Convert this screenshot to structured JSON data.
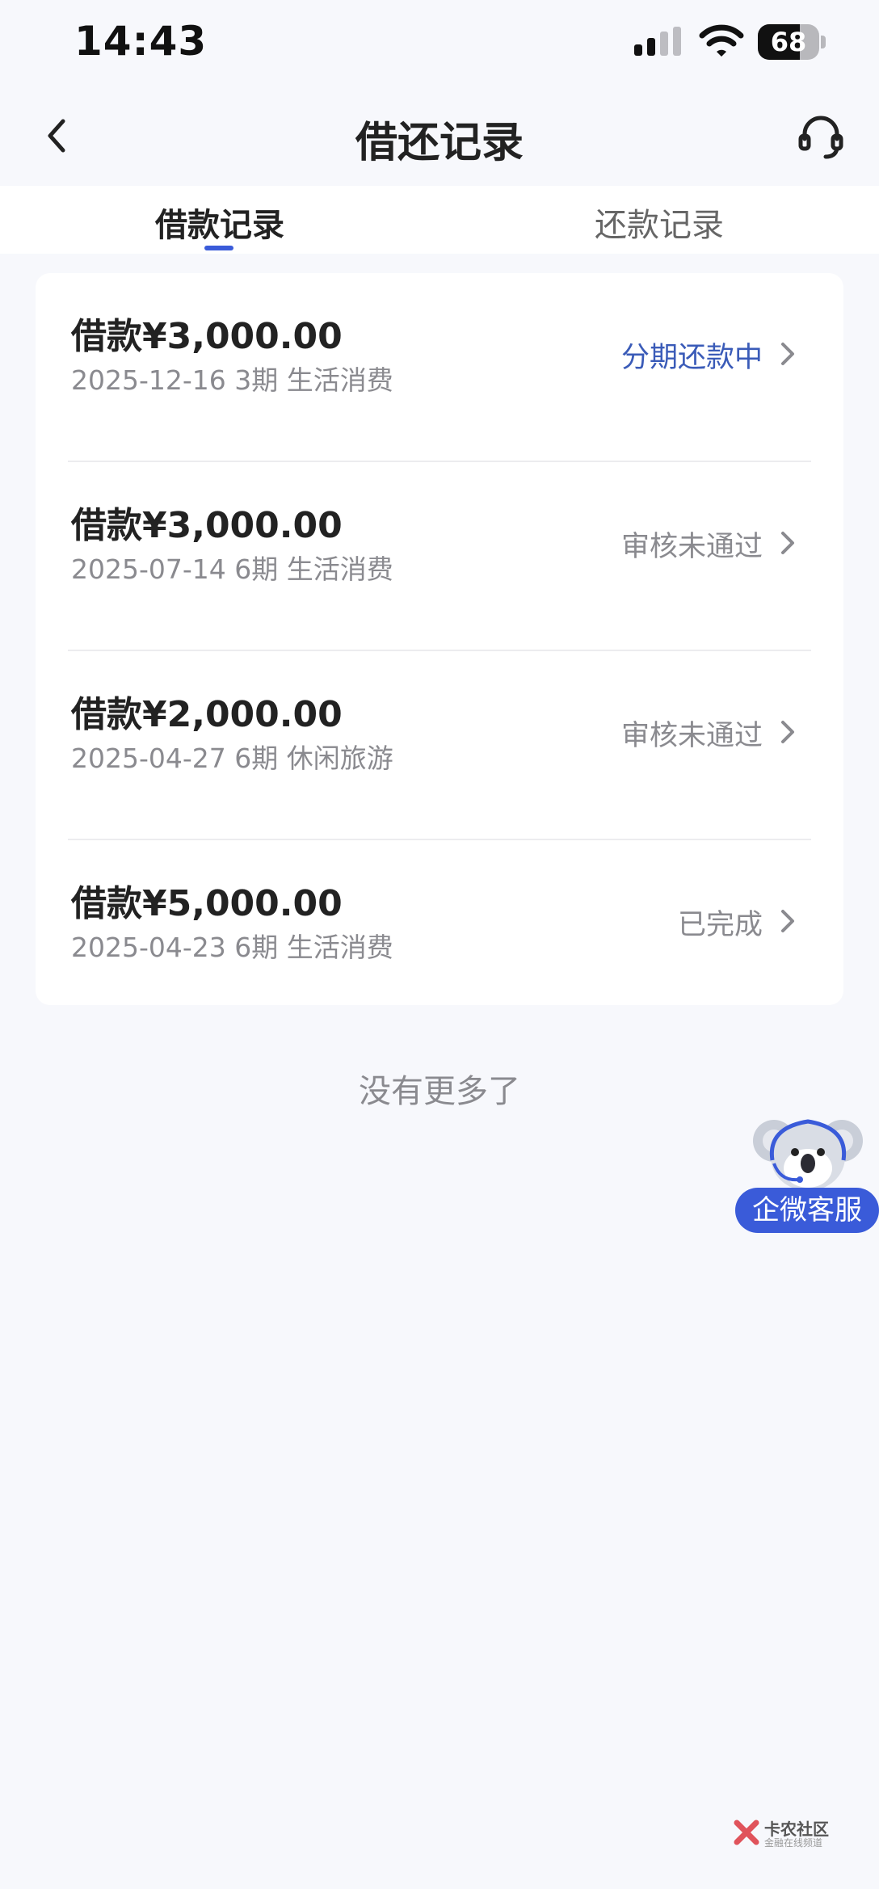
{
  "status_bar": {
    "time": "14:43",
    "battery": "68",
    "battery_level": 0.68
  },
  "nav": {
    "title": "借还记录",
    "back_icon": "chevron-left-icon",
    "cs_icon": "headset-icon"
  },
  "tabs": [
    {
      "label": "借款记录",
      "active": true
    },
    {
      "label": "还款记录",
      "active": false
    }
  ],
  "records": [
    {
      "amount": "借款¥3,000.00",
      "meta": "2025-12-16 3期  生活消费",
      "status": "分期还款中",
      "status_active": true
    },
    {
      "amount": "借款¥3,000.00",
      "meta": "2025-07-14 6期  生活消费",
      "status": "审核未通过",
      "status_active": false
    },
    {
      "amount": "借款¥2,000.00",
      "meta": "2025-04-27 6期  休闲旅游",
      "status": "审核未通过",
      "status_active": false
    },
    {
      "amount": "借款¥5,000.00",
      "meta": "2025-04-23 6期  生活消费",
      "status": "已完成",
      "status_active": false
    }
  ],
  "footer": {
    "no_more": "没有更多了"
  },
  "float_service": {
    "label": "企微客服",
    "icon": "koala-headset-icon"
  },
  "watermark": {
    "text": "卡农社区",
    "sub": "金融在线频道"
  },
  "colors": {
    "accent": "#3a5bd9",
    "status_active": "#3a5bb8",
    "muted": "#8a8a8f",
    "background": "#f7f8fc"
  }
}
